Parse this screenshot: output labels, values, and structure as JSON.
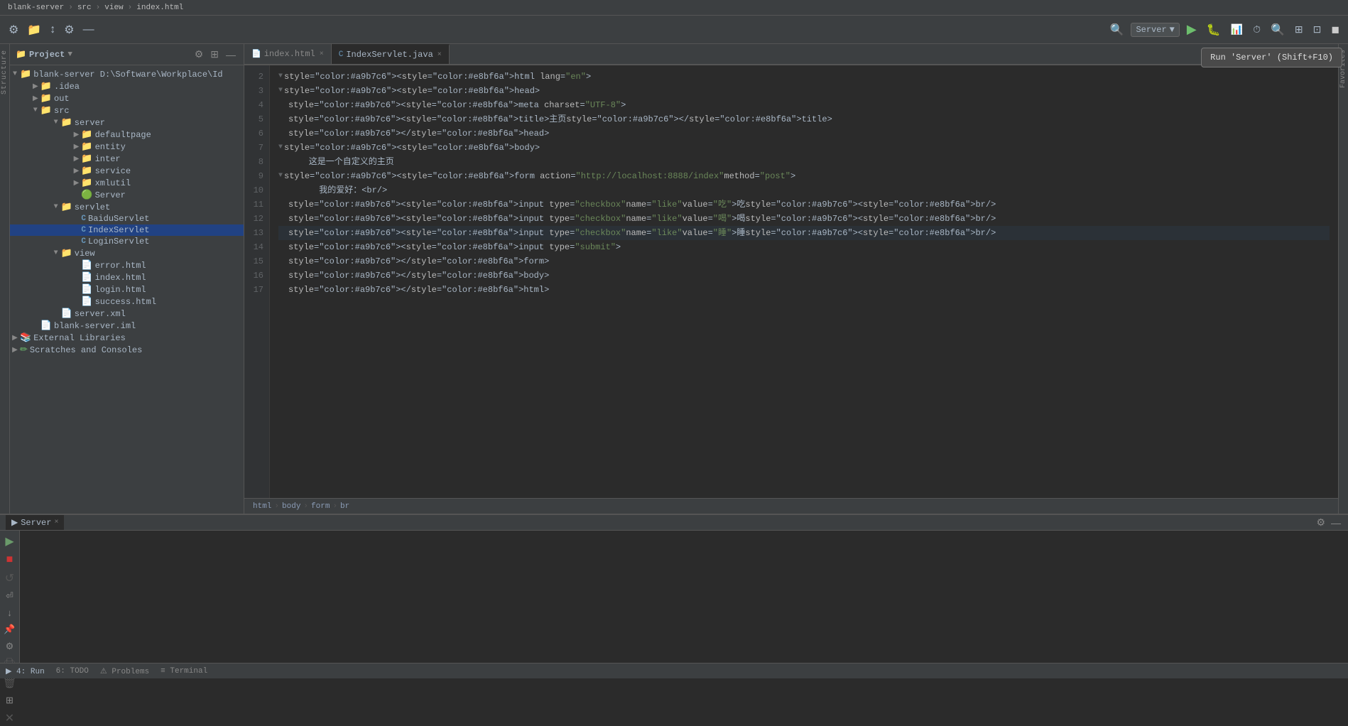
{
  "titlebar": {
    "project": "blank-server",
    "src": "src",
    "view": "view",
    "file": "index.html"
  },
  "toolbar": {
    "run_config": "Server",
    "run_tooltip": "Run 'Server' (Shift+F10)"
  },
  "project_panel": {
    "title": "Project",
    "root": {
      "name": "blank-server",
      "path": "D:\\Software\\Workplace\\Id"
    },
    "tree": [
      {
        "id": "blank-server-root",
        "label": "blank-server D:\\Software\\Workplace\\Id",
        "indent": 0,
        "type": "project",
        "expanded": true
      },
      {
        "id": "idea",
        "label": ".idea",
        "indent": 1,
        "type": "folder",
        "expanded": false
      },
      {
        "id": "out",
        "label": "out",
        "indent": 1,
        "type": "folder-orange",
        "expanded": false
      },
      {
        "id": "src",
        "label": "src",
        "indent": 1,
        "type": "folder-src",
        "expanded": true
      },
      {
        "id": "server",
        "label": "server",
        "indent": 2,
        "type": "folder",
        "expanded": true
      },
      {
        "id": "defaultpage",
        "label": "defaultpage",
        "indent": 3,
        "type": "folder",
        "expanded": false
      },
      {
        "id": "entity",
        "label": "entity",
        "indent": 3,
        "type": "folder",
        "expanded": false
      },
      {
        "id": "inter",
        "label": "inter",
        "indent": 3,
        "type": "folder",
        "expanded": false
      },
      {
        "id": "service",
        "label": "service",
        "indent": 3,
        "type": "folder",
        "expanded": false
      },
      {
        "id": "xmlutil",
        "label": "xmlutil",
        "indent": 3,
        "type": "folder",
        "expanded": false
      },
      {
        "id": "Server",
        "label": "Server",
        "indent": 3,
        "type": "server-class",
        "expanded": false
      },
      {
        "id": "servlet",
        "label": "servlet",
        "indent": 2,
        "type": "folder",
        "expanded": true
      },
      {
        "id": "BaiduServlet",
        "label": "BaiduServlet",
        "indent": 3,
        "type": "java-class",
        "expanded": false
      },
      {
        "id": "IndexServlet",
        "label": "IndexServlet",
        "indent": 3,
        "type": "java-class-active",
        "expanded": false
      },
      {
        "id": "LoginServlet",
        "label": "LoginServlet",
        "indent": 3,
        "type": "java-class",
        "expanded": false
      },
      {
        "id": "view-folder",
        "label": "view",
        "indent": 2,
        "type": "folder",
        "expanded": true
      },
      {
        "id": "error.html",
        "label": "error.html",
        "indent": 3,
        "type": "html",
        "expanded": false
      },
      {
        "id": "index.html",
        "label": "index.html",
        "indent": 3,
        "type": "html",
        "expanded": false
      },
      {
        "id": "login.html",
        "label": "login.html",
        "indent": 3,
        "type": "html",
        "expanded": false
      },
      {
        "id": "success.html",
        "label": "success.html",
        "indent": 3,
        "type": "html",
        "expanded": false
      },
      {
        "id": "server.xml",
        "label": "server.xml",
        "indent": 2,
        "type": "xml",
        "expanded": false
      },
      {
        "id": "blank-server.iml",
        "label": "blank-server.iml",
        "indent": 1,
        "type": "iml",
        "expanded": false
      },
      {
        "id": "External Libraries",
        "label": "External Libraries",
        "indent": 0,
        "type": "ext-lib",
        "expanded": false
      },
      {
        "id": "Scratches and Consoles",
        "label": "Scratches and Consoles",
        "indent": 0,
        "type": "scratches",
        "expanded": false
      }
    ]
  },
  "tabs": [
    {
      "id": "index.html",
      "label": "index.html",
      "type": "html",
      "active": false,
      "closeable": true
    },
    {
      "id": "IndexServlet.java",
      "label": "IndexServlet.java",
      "type": "java",
      "active": true,
      "closeable": true
    }
  ],
  "editor": {
    "lines": [
      {
        "num": 2,
        "content": "<html lang=\"en\">",
        "type": "html",
        "indent": 0
      },
      {
        "num": 3,
        "content": "  <head>",
        "type": "html",
        "indent": 0
      },
      {
        "num": 4,
        "content": "    <meta charset=\"UTF-8\">",
        "type": "html",
        "indent": 1
      },
      {
        "num": 5,
        "content": "    <title>主页</title>",
        "type": "html",
        "indent": 1
      },
      {
        "num": 6,
        "content": "  </head>",
        "type": "html",
        "indent": 0
      },
      {
        "num": 7,
        "content": "  <body>",
        "type": "html",
        "indent": 0
      },
      {
        "num": 8,
        "content": "    这是一个自定义的主页",
        "type": "text",
        "indent": 1
      },
      {
        "num": 9,
        "content": "    <form action=\"http://localhost:8888/index\" method=\"post\">",
        "type": "html",
        "indent": 1
      },
      {
        "num": 10,
        "content": "      我的爱好：<br/>",
        "type": "text",
        "indent": 2
      },
      {
        "num": 11,
        "content": "      <input type=\"checkbox\" name=\"like\" value=\"吃\">吃<br/>",
        "type": "html",
        "indent": 2
      },
      {
        "num": 12,
        "content": "      <input type=\"checkbox\" name=\"like\" value=\"喝\">喝<br/>",
        "type": "html",
        "indent": 2
      },
      {
        "num": 13,
        "content": "      <input type=\"checkbox\" name=\"like\" value=\"睡\">睡<br/>",
        "type": "html",
        "indent": 2,
        "highlight": true
      },
      {
        "num": 14,
        "content": "      <input type=\"submit\">",
        "type": "html",
        "indent": 2
      },
      {
        "num": 15,
        "content": "    </form>",
        "type": "html",
        "indent": 1
      },
      {
        "num": 16,
        "content": "  </body>",
        "type": "html",
        "indent": 0
      },
      {
        "num": 17,
        "content": "  </html>",
        "type": "html",
        "indent": 0
      }
    ]
  },
  "breadcrumb": {
    "items": [
      "html",
      "body",
      "form",
      "br"
    ]
  },
  "run_panel": {
    "tab_label": "Server",
    "close_label": "×"
  },
  "footer_tabs": [
    {
      "label": "4: Run",
      "icon": "▶",
      "active": true
    },
    {
      "label": "6: TODO",
      "icon": ""
    },
    {
      "label": "⚠ Problems",
      "icon": ""
    },
    {
      "label": "≡ Terminal",
      "icon": ""
    }
  ],
  "colors": {
    "accent": "#214283",
    "bg_dark": "#2b2b2b",
    "bg_panel": "#3c3f41",
    "text_primary": "#a9b7c6",
    "tag_color": "#e8bf6a",
    "string_color": "#6a8759",
    "java_color": "#6897bb"
  }
}
